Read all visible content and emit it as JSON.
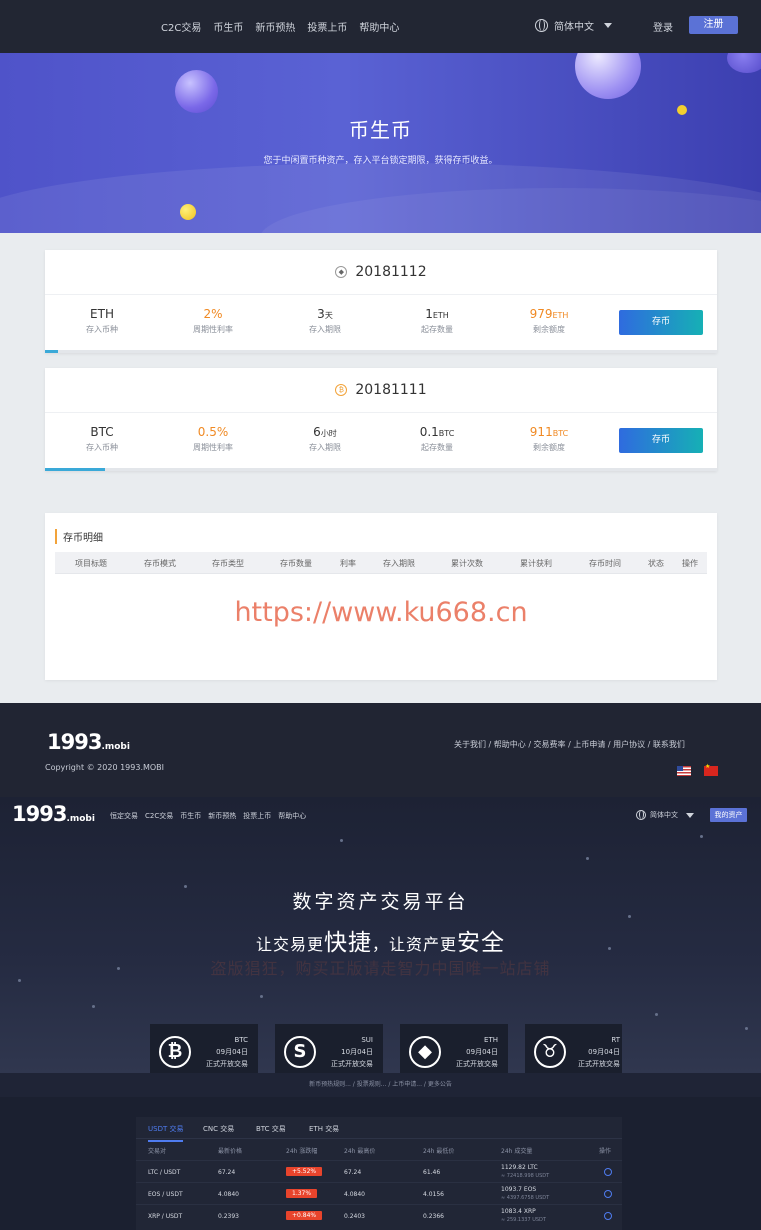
{
  "nav": {
    "links": [
      "C2C交易",
      "币生币",
      "新币预热",
      "投票上币",
      "帮助中心"
    ],
    "language": "简体中文",
    "login": "登录",
    "register": "注册"
  },
  "hero": {
    "title": "币生币",
    "subtitle": "您于中闲置币种资产，存入平台锁定期限，获得存币收益。"
  },
  "products": [
    {
      "name": "20181112",
      "icon": "ethereum-icon",
      "currency": "ETH",
      "currency_label": "存入币种",
      "rate": "2%",
      "rate_label": "周期性利率",
      "period_num": "3",
      "period_unit": "天",
      "period_label": "存入期限",
      "min_num": "1",
      "min_unit": "ETH",
      "min_label": "起存数量",
      "remain_num": "979",
      "remain_unit": "ETH",
      "remain_label": "剩余额度",
      "button": "存币",
      "progress": 0.02
    },
    {
      "name": "20181111",
      "icon": "bitcoin-icon",
      "currency": "BTC",
      "currency_label": "存入币种",
      "rate": "0.5%",
      "rate_label": "周期性利率",
      "period_num": "6",
      "period_unit": "小时",
      "period_label": "存入期限",
      "min_num": "0.1",
      "min_unit": "BTC",
      "min_label": "起存数量",
      "remain_num": "911",
      "remain_unit": "BTC",
      "remain_label": "剩余额度",
      "button": "存币",
      "progress": 0.09
    }
  ],
  "detail": {
    "title": "存币明细",
    "columns": [
      "项目标题",
      "存币模式",
      "存币类型",
      "存币数量",
      "利率",
      "存入期限",
      "累计次数",
      "累计获利",
      "存币时间",
      "状态",
      "操作"
    ],
    "watermark": "https://www.ku668.cn"
  },
  "footer": {
    "logo": "1993",
    "logo_suffix": ".mobi",
    "copyright": "Copyright © 2020 1993.MOBI",
    "links": "关于我们 / 帮助中心 / 交易费率 / 上币申请 / 用户协议 / 联系我们"
  },
  "second": {
    "logo": "1993",
    "logo_suffix": ".mobi",
    "links": [
      "恒定交易",
      "C2C交易",
      "币生币",
      "新币预热",
      "投票上币",
      "帮助中心"
    ],
    "language": "简体中文",
    "button": "我的资产",
    "headline": "数字资产交易平台",
    "slogan_a": "让交易更",
    "slogan_b": "快捷",
    "slogan_c": "，让资产更",
    "slogan_d": "安全",
    "ghost": "盗版猖狂，购买正版请走智力中国唯一站店铺",
    "cards": [
      {
        "icon": "bitcoin-icon",
        "coin": "BTC",
        "date": "09月04日",
        "status": "正式开放交易"
      },
      {
        "icon": "sui-icon",
        "coin": "SUI",
        "date": "10月04日",
        "status": "正式开放交易"
      },
      {
        "icon": "ethereum-icon",
        "coin": "ETH",
        "date": "09月04日",
        "status": "正式开放交易"
      },
      {
        "icon": "bull-icon",
        "coin": "RT",
        "date": "09月04日",
        "status": "正式开放交易"
      }
    ],
    "notice": "新币预热规则...  /  投票规则...  /  上币申请...  /  更多公告",
    "tabs": [
      "USDT 交易",
      "CNC 交易",
      "BTC 交易",
      "ETH 交易"
    ],
    "columns": [
      "交易对",
      "最新价格",
      "24h 涨跌幅",
      "24h 最高价",
      "24h 最低价",
      "24h 成交量",
      "操作"
    ],
    "rows": [
      {
        "pair": "LTC / USDT",
        "price": "67.24",
        "change": "+5.52%",
        "high": "67.24",
        "low": "61.46",
        "vol": "1129.82 LTC",
        "vol2": "≈ 72418.998 USDT"
      },
      {
        "pair": "EOS / USDT",
        "price": "4.0840",
        "change": "1.37%",
        "high": "4.0840",
        "low": "4.0156",
        "vol": "1093.7 EOS",
        "vol2": "≈ 4397.6758 USDT"
      },
      {
        "pair": "XRP / USDT",
        "price": "0.2393",
        "change": "+0.84%",
        "high": "0.2403",
        "low": "0.2366",
        "vol": "1083.4 XRP",
        "vol2": "≈ 259.1337 USDT"
      }
    ]
  }
}
